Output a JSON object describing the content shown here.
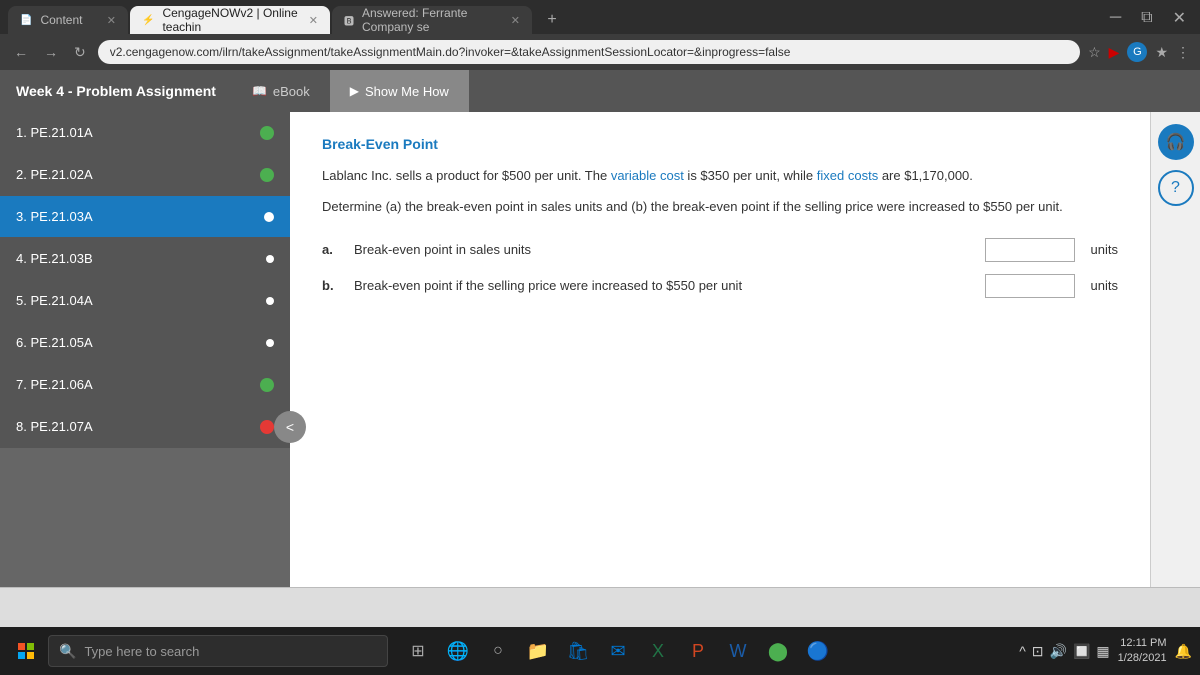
{
  "browser": {
    "tabs": [
      {
        "id": "content",
        "label": "Content",
        "icon": "📄",
        "active": false
      },
      {
        "id": "cengage",
        "label": "CengageNOWv2 | Online teachin",
        "icon": "⚡",
        "active": true
      },
      {
        "id": "answered",
        "label": "Answered: Ferrante Company se",
        "icon": "🅱",
        "active": false
      }
    ],
    "address": "v2.cengagenow.com/ilrn/takeAssignment/takeAssignmentMain.do?invoker=&takeAssignmentSessionLocator=&inprogress=false"
  },
  "app": {
    "title": "Week 4 - Problem Assignment",
    "tabs": [
      {
        "id": "ebook",
        "label": "eBook",
        "icon": "📖"
      },
      {
        "id": "showmehow",
        "label": "Show Me How",
        "icon": "▶"
      }
    ]
  },
  "sidebar": {
    "items": [
      {
        "id": "pe2101a",
        "label": "1. PE.21.01A",
        "status": "green"
      },
      {
        "id": "pe2102a",
        "label": "2. PE.21.02A",
        "status": "green"
      },
      {
        "id": "pe2103a",
        "label": "3. PE.21.03A",
        "status": "blue",
        "selected": true
      },
      {
        "id": "pe2103b",
        "label": "4. PE.21.03B",
        "status": "dot"
      },
      {
        "id": "pe2104a",
        "label": "5. PE.21.04A",
        "status": "dot"
      },
      {
        "id": "pe2105a",
        "label": "6. PE.21.05A",
        "status": "dot"
      },
      {
        "id": "pe2106a",
        "label": "7. PE.21.06A",
        "status": "green"
      },
      {
        "id": "pe2107a",
        "label": "8. PE.21.07A",
        "status": "red"
      }
    ]
  },
  "content": {
    "title": "Break-Even Point",
    "paragraph1_pre": "Lablanc Inc. sells a product for $500 per unit. The ",
    "paragraph1_var": "variable cost",
    "paragraph1_mid": " is $350 per unit, while ",
    "paragraph1_fixed": "fixed costs",
    "paragraph1_post": " are $1,170,000.",
    "paragraph2": "Determine (a) the break-even point in sales units and (b) the break-even point if the selling price were increased to $550 per unit.",
    "questions": [
      {
        "label": "a.",
        "text": "Break-even point in sales units",
        "unit": "units"
      },
      {
        "label": "b.",
        "text": "Break-even point if the selling price were increased to $550 per unit",
        "unit": "units"
      }
    ]
  },
  "taskbar": {
    "search_placeholder": "Type here to search",
    "clock": {
      "time": "12:11 PM",
      "date": "1/28/2021"
    }
  }
}
